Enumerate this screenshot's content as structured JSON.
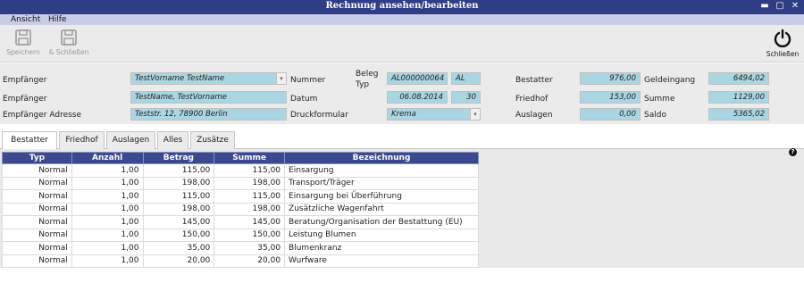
{
  "window": {
    "title": "Rechnung ansehen/bearbeiten",
    "controls": [
      "▬",
      "▢",
      "✕"
    ]
  },
  "menu": [
    "Ansicht",
    "Hilfe"
  ],
  "toolbar": {
    "save": "Speichern",
    "save_close": "& Schließen",
    "close": "Schließen"
  },
  "form": {
    "empfaenger_label": "Empfänger",
    "empfaenger_value": "TestVorname TestName",
    "empfaenger2_label": "Empfänger",
    "empfaenger2_value": "TestName, TestVorname",
    "adresse_label": "Empfänger Adresse",
    "adresse_value": "Teststr. 12, 78900 Berlin",
    "nummer_label": "Nummer",
    "datum_label": "Datum",
    "druckformular_label": "Druckformular",
    "beleg_label_1": "Beleg",
    "beleg_label_2": "Typ",
    "nummer_value": "AL000000064",
    "beleg_typ_value": "AL",
    "datum_value": "06.08.2014",
    "datum_days": "30",
    "druckformular_value": "Krema",
    "bestatter_label": "Bestatter",
    "bestatter_value": "976,00",
    "friedhof_label": "Friedhof",
    "friedhof_value": "153,00",
    "auslagen_label": "Auslagen",
    "auslagen_value": "0,00",
    "geldeingang_label": "Geldeingang",
    "geldeingang_value": "6494,02",
    "summe_label": "Summe",
    "summe_value": "1129,00",
    "saldo_label": "Saldo",
    "saldo_value": "5365,02"
  },
  "tabs": [
    "Bestatter",
    "Friedhof",
    "Auslagen",
    "Alles",
    "Zusätze"
  ],
  "active_tab": "Bestatter",
  "table": {
    "columns": [
      "Typ",
      "Anzahl",
      "Betrag",
      "Summe",
      "Bezeichnung"
    ],
    "rows": [
      [
        "Normal",
        "1,00",
        "115,00",
        "115,00",
        "Einsargung"
      ],
      [
        "Normal",
        "1,00",
        "198,00",
        "198,00",
        "Transport/Träger"
      ],
      [
        "Normal",
        "1,00",
        "115,00",
        "115,00",
        "Einsargung bei Überführung"
      ],
      [
        "Normal",
        "1,00",
        "198,00",
        "198,00",
        "Zusätzliche Wagenfahrt"
      ],
      [
        "Normal",
        "1,00",
        "145,00",
        "145,00",
        "Beratung/Organisation der Bestattung (EU)"
      ],
      [
        "Normal",
        "1,00",
        "150,00",
        "150,00",
        "Leistung Blumen"
      ],
      [
        "Normal",
        "1,00",
        "35,00",
        "35,00",
        "Blumenkranz"
      ],
      [
        "Normal",
        "1,00",
        "20,00",
        "20,00",
        "Wurfware"
      ]
    ]
  },
  "help": "?"
}
